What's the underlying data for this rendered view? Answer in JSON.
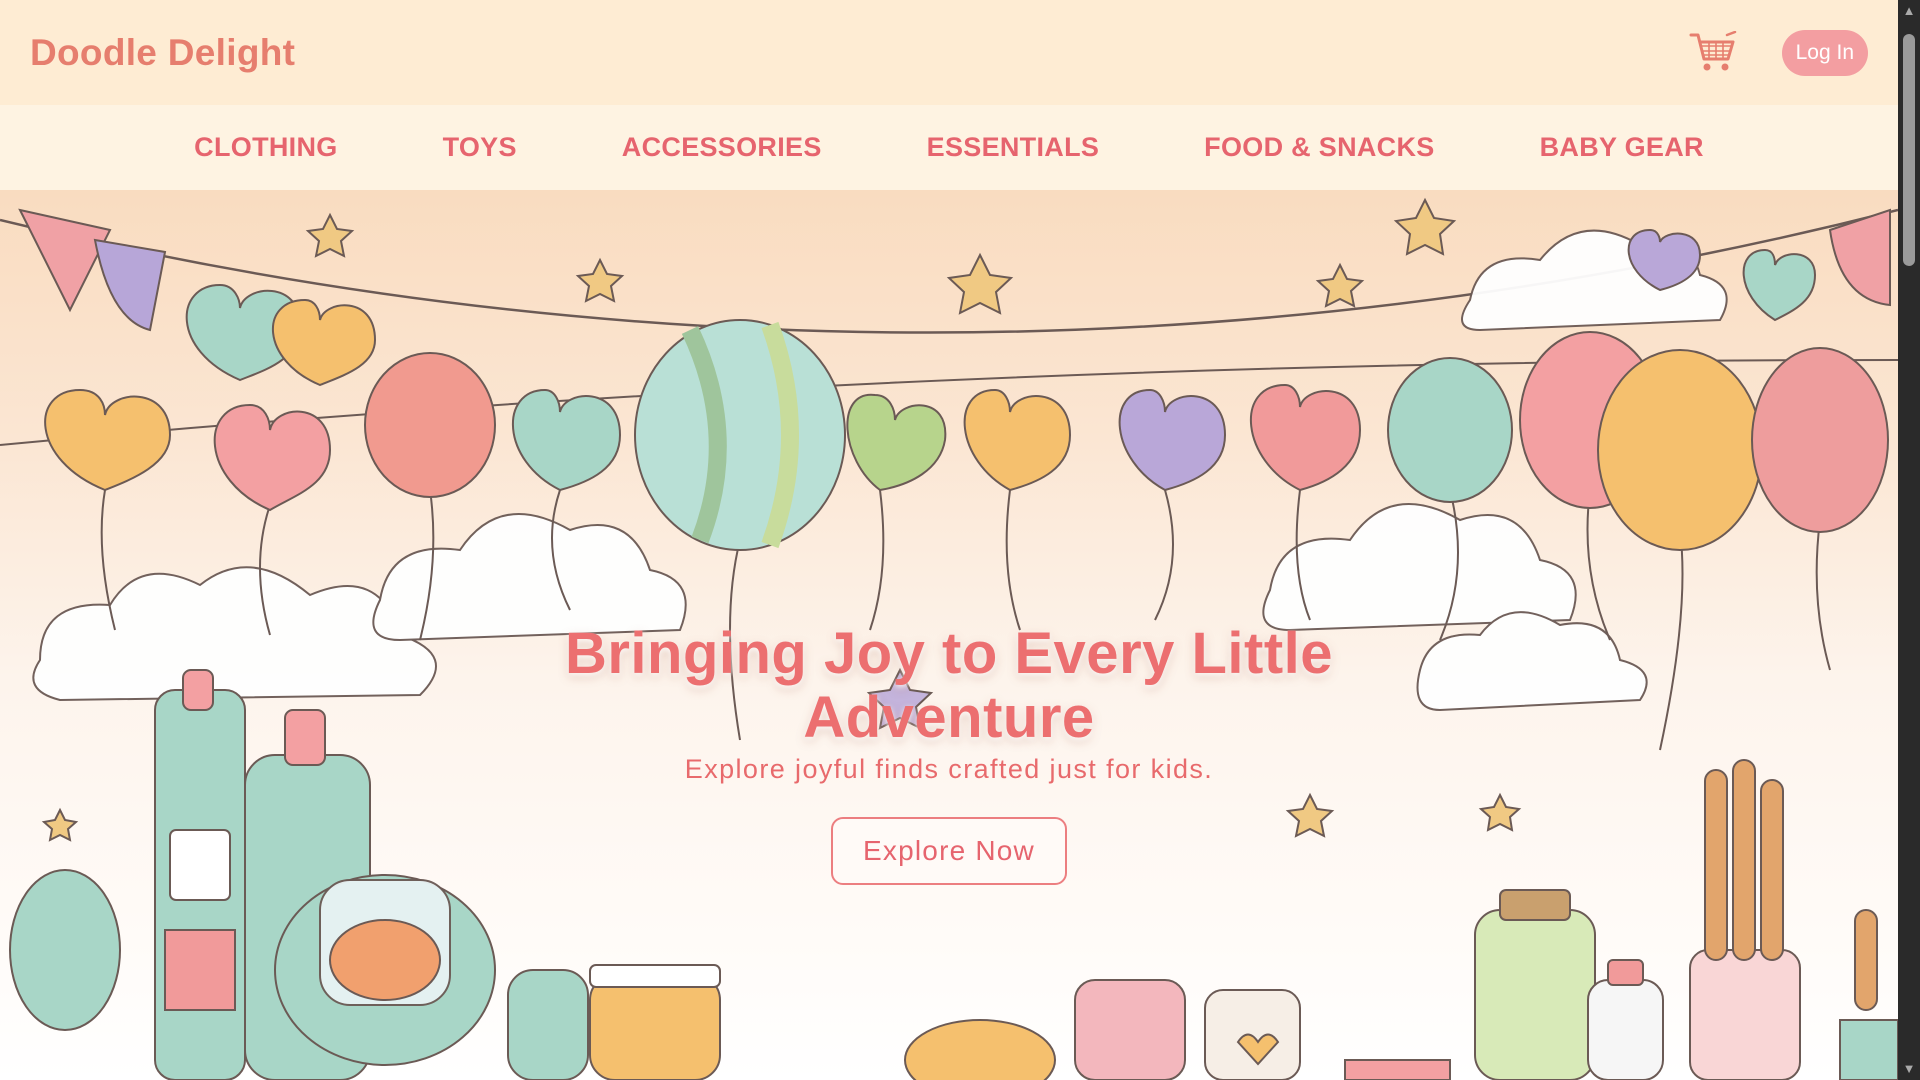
{
  "header": {
    "logo": "Doodle Delight",
    "cart_icon": "shopping-cart-icon",
    "login_label": "Log In"
  },
  "nav": {
    "items": [
      {
        "label": "CLOTHING"
      },
      {
        "label": "TOYS"
      },
      {
        "label": "ACCESSORIES"
      },
      {
        "label": "ESSENTIALS"
      },
      {
        "label": "FOOD & SNACKS"
      },
      {
        "label": "BABY GEAR"
      }
    ]
  },
  "hero": {
    "title": "Bringing Joy to Every Little Adventure",
    "subtitle": "Explore joyful finds crafted just for kids.",
    "cta_label": "Explore Now"
  },
  "colors": {
    "brand": "#e67e6e",
    "accent": "#ec6f70",
    "topbar_bg": "#feecd3",
    "nav_bg": "#fef3e2",
    "login_bg": "#f39ea1"
  }
}
